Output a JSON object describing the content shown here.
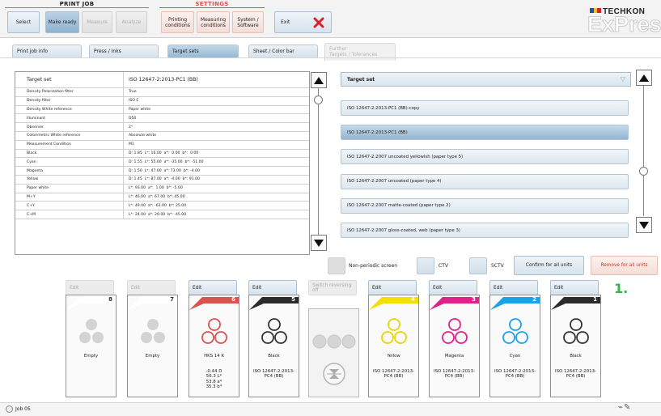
{
  "header": {
    "print_job_title": "PRINT JOB",
    "settings_title": "SETTINGS",
    "buttons": [
      "Select",
      "Make ready",
      "Measure",
      "Analyze"
    ],
    "settings_buttons": [
      "Printing\nconditions",
      "Measuring\nconditions",
      "System /\nSoftware"
    ],
    "exit_label": "Exit",
    "brand": "TECHKON",
    "product": "ExPresso",
    "colors": {
      "accent": "#8fb2ce",
      "exit_x": "#d9202a",
      "step": "#35b44a"
    }
  },
  "tabs": [
    "Print job info",
    "Press / Inks",
    "Target sets",
    "Sheet / Color bar",
    "Further\nTargets / Tolerances"
  ],
  "table": {
    "header": [
      "Target set",
      "ISO 12647-2:2013-PC1 (BB)"
    ],
    "rows": [
      [
        "Density Polarization filter",
        "True"
      ],
      [
        "Density filter",
        "ISO E"
      ],
      [
        "Density White reference",
        "Paper white"
      ],
      [
        "Illuminant",
        "D50"
      ],
      [
        "Observer",
        "2°"
      ],
      [
        "Colorimetric White reference",
        "Absolute white"
      ],
      [
        "Measurement Condition",
        "M1"
      ],
      [
        "Black",
        "D: 1.85  L*: 16.00  a*:  0.00  b*:  0.00"
      ],
      [
        "Cyan",
        "D: 1.55  L*: 55.00  a*: -35.00  b*: -51.00"
      ],
      [
        "Magenta",
        "D: 1.50  L*: 47.00  a*: 73.00  b*: -4.00"
      ],
      [
        "Yellow",
        "D: 1.45  L*: 87.00  a*: -4.00  b*: 91.00"
      ],
      [
        "Paper white",
        "L*: 93.00  a*:  1.00  b*: -5.00"
      ],
      [
        "M+Y",
        "L*: 46.00  a*: 67.00  b*: 45.00"
      ],
      [
        "C+Y",
        "L*: 49.00  a*: -63.00  b*: 25.00"
      ],
      [
        "C+M",
        "L*: 24.00  a*: 20.00  b*: -45.00"
      ]
    ]
  },
  "target_sets": {
    "header": "Target set",
    "items": [
      "ISO 12647-2:2013-PC1 (BB)-copy",
      "ISO 12647-2:2013-PC1 (BB)",
      "ISO 12647-2:2007 uncoated yellowish (paper type 5)",
      "ISO 12647-2:2007 uncoated (paper type 4)",
      "ISO 12647-2:2007 matte-coated (paper type 2)",
      "ISO 12647-2:2007 gloss-coated, web (paper type 3)"
    ],
    "selected_index": 1
  },
  "options": {
    "non_periodic": "Non-periodic screen",
    "ctv": "CTV",
    "sctv": "SCTV",
    "confirm_all": "Confirm for all units",
    "remove_all": "Remove for all units"
  },
  "step_label": "1.",
  "units": [
    {
      "edit": "Edit",
      "num": "8",
      "color": "#e0e0e0",
      "ring": "#c9c9c9",
      "fill": true,
      "name": "Empty",
      "value": "",
      "enabled": false
    },
    {
      "edit": "Edit",
      "num": "7",
      "color": "#e0e0e0",
      "ring": "#c9c9c9",
      "fill": true,
      "name": "Empty",
      "value": "",
      "enabled": false
    },
    {
      "edit": "Edit",
      "num": "6",
      "color": "#d9534f",
      "ring": "#d9534f",
      "fill": false,
      "name": "HKS 14 K",
      "value": "-0.44 D\n56.3 L*\n53.8 a*\n35.3 b*",
      "enabled": true
    },
    {
      "edit": "Edit",
      "num": "5",
      "color": "#2b2b2b",
      "ring": "#333333",
      "fill": false,
      "name": "Black",
      "value": "ISO 12647-2:2013-\nPC4 (BB)",
      "enabled": true
    },
    {
      "edit": "Switch reversing off",
      "num": "",
      "color": "",
      "ring": "",
      "fill": false,
      "name": "",
      "value": "",
      "enabled": false
    },
    {
      "edit": "Edit",
      "num": "4",
      "color": "#f2e000",
      "ring": "#e8d400",
      "fill": false,
      "name": "Yellow",
      "value": "ISO 12647-2:2013-\nPC4 (BB)",
      "enabled": true
    },
    {
      "edit": "Edit",
      "num": "3",
      "color": "#e0218a",
      "ring": "#e0218a",
      "fill": false,
      "name": "Magenta",
      "value": "ISO 12647-2:2013-\nPC4 (BB)",
      "enabled": true
    },
    {
      "edit": "Edit",
      "num": "2",
      "color": "#1aa3e8",
      "ring": "#1aa3e8",
      "fill": false,
      "name": "Cyan",
      "value": "ISO 12647-2:2013-\nPC4 (BB)",
      "enabled": true
    },
    {
      "edit": "Edit",
      "num": "1",
      "color": "#2b2b2b",
      "ring": "#333333",
      "fill": false,
      "name": "Black",
      "value": "ISO 12647-2:2013-\nPC4 (BB)",
      "enabled": true
    }
  ],
  "status": {
    "job": "Job 05"
  }
}
